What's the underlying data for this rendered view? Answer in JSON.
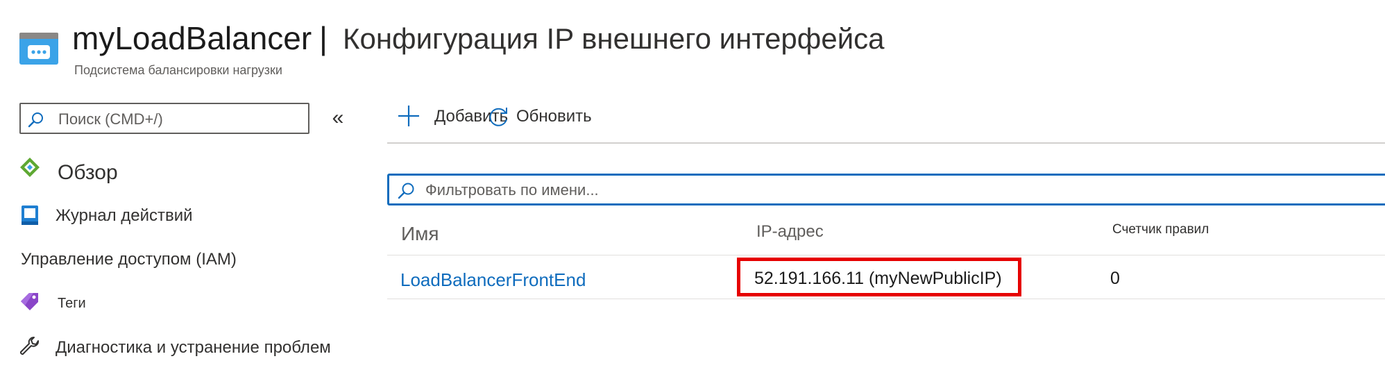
{
  "header": {
    "resource_name": "myLoadBalancer",
    "separator": "|",
    "page_title": "Конфигурация IP внешнего интерфейса",
    "resource_type": "Подсистема балансировки нагрузки"
  },
  "sidebar": {
    "search_placeholder": "Поиск (CMD+/)",
    "collapse_label": "«",
    "items": [
      {
        "label": "Обзор",
        "icon": "overview-icon"
      },
      {
        "label": "Журнал действий",
        "icon": "activity-log-icon"
      },
      {
        "label": "Управление доступом (IAM)",
        "icon": ""
      },
      {
        "label": "Теги",
        "icon": "tag-icon"
      },
      {
        "label": "Диагностика и устранение проблем",
        "icon": "wrench-icon"
      }
    ]
  },
  "toolbar": {
    "add_label": "Добавить",
    "refresh_label": "Обновить"
  },
  "filter": {
    "placeholder": "Фильтровать по имени..."
  },
  "table": {
    "columns": [
      "Имя",
      "IP-адрес",
      "Счетчик правил"
    ],
    "rows": [
      {
        "name": "LoadBalancerFrontEnd",
        "ip": "52.191.166.11 (myNewPublicIP)",
        "rules": "0"
      }
    ]
  },
  "colors": {
    "accent": "#0f6cbd",
    "highlight": "#e60000",
    "icon_blue": "#3ba3e8"
  }
}
